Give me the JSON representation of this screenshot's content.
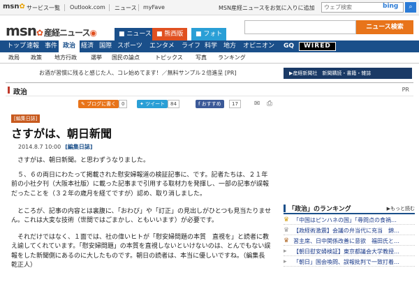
{
  "topbar": {
    "logo": "msn",
    "links": [
      "サービス一覧",
      "Outlook.com",
      "ニュース",
      "myFave"
    ],
    "home_link": "MSN産経ニュースをお気に入りに追加",
    "search_placeholder": "ウェブ検索",
    "bing": "bing"
  },
  "header": {
    "logo_main": "msn",
    "logo_sub": "産経ニュース",
    "tabs": [
      "ニュース",
      "熊西版",
      "フォト"
    ],
    "search_button": "ニュース検索"
  },
  "nav1": [
    "トップ",
    "速報",
    "事件",
    "政治",
    "経済",
    "国際",
    "スポーツ",
    "エンタメ",
    "ライフ",
    "科学",
    "地方",
    "オピニオン",
    "GQ",
    "WIRED"
  ],
  "nav1_active": "政治",
  "nav2": [
    "政局",
    "政策",
    "地方行政",
    "選挙",
    "国民の論点",
    "トピックス",
    "写真",
    "ランキング"
  ],
  "ad": {
    "text": "お酒が習慣に残ると感じた人、コレ始めてます！／無料サンプル２倍進呈 [PR]"
  },
  "news_banner": "▶産経新聞社　新聞購読・書籍・雑誌",
  "section": {
    "title": "政治",
    "pr": "PR"
  },
  "social": {
    "blog_label": "ブログに書く",
    "blog_count": "0",
    "tweet_label": "ツイート",
    "tweet_count": "84",
    "fb_label": "おすすめ",
    "fb_count": "17"
  },
  "article": {
    "badge": "[編集日誌]",
    "headline": "さすがは、朝日新聞",
    "date": "2014.8.7 10:00",
    "category": "[編集日誌]",
    "paragraphs": [
      "さすがは、朝日新聞。と思わずうなりました。",
      "５、６の両日にわたって掲載された慰安婦報道の検証記事に、です。記者たちは、２１年前の小社夕刊（大阪本社版）に載った記事まで引用する取材力を発揮し、一部の記事が誤報だったことを（３２年の歳月を経てですが）認め、取り消しました。",
      "ところが、記事の内容とは裏腹に、「おわび」や「訂正」の見出しがひとつも見当たりません。これは大変な技術（世間ではごまかし、ともいいます）が必要です。",
      "それだけではなく、１面では、社の偉いヒトが「慰安婦問題の本質　直視を」と読者に教え諭してくれています。「慰安婦問題」の本質を直視しないといけないのは、とんでもない誤報をした新聞側にあるのに大したものです。朝日の読者は、本当に優しいですね。（編集長　乾正人）"
    ]
  },
  "ranking": {
    "title": "「政治」のランキング",
    "more": "▶もっと読む",
    "items": [
      "「中国はピンハネの国」「尋問点の食禍…",
      "【政経術激震】会議の弁当代に充当　錦…",
      "習主席、日中関係改善に意欲　福田氏と…",
      "【朝日慰安婦検証】東京都議会大学教授…",
      "「朝日」国会喚問、誤報批判で一致打着…"
    ]
  },
  "colors": {
    "nav": "#1a4f8a",
    "accent_orange": "#e8741a",
    "badge": "#c85a1e"
  }
}
